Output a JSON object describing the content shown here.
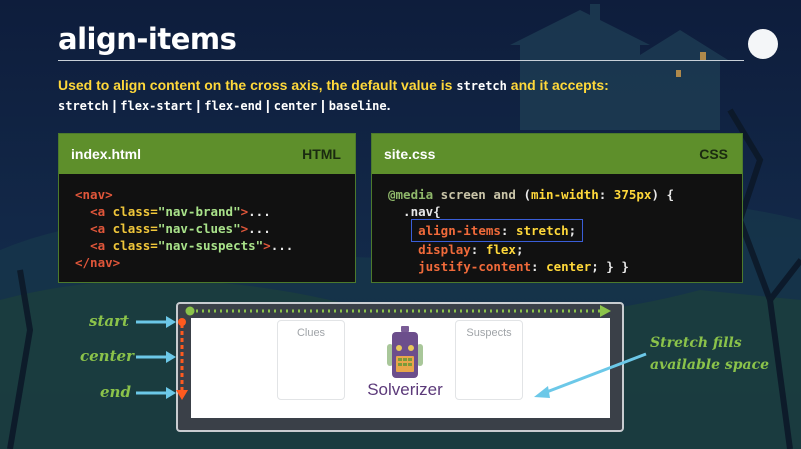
{
  "slide": {
    "title": "align-items",
    "subtitle_line1_pre": "Used to align content on the cross axis, the default value is ",
    "subtitle_line1_code": "stretch",
    "subtitle_line1_post": " and it accepts:",
    "accepted_values": [
      "stretch",
      "flex-start",
      "flex-end",
      "center",
      "baseline"
    ],
    "separator": " | ",
    "subtitle_line2_end": "."
  },
  "html_panel": {
    "filename": "index.html",
    "language": "HTML",
    "lines": [
      {
        "open": "<nav>"
      },
      {
        "indent": "  ",
        "tag": "<a",
        "attr": " class=",
        "str": "\"nav-brand\"",
        "close": ">",
        "txt": "..."
      },
      {
        "indent": "  ",
        "tag": "<a",
        "attr": " class=",
        "str": "\"nav-clues\"",
        "close": ">",
        "txt": "..."
      },
      {
        "indent": "  ",
        "tag": "<a",
        "attr": " class=",
        "str": "\"nav-suspects\"",
        "close": ">",
        "txt": "..."
      },
      {
        "open": "</nav>"
      }
    ]
  },
  "css_panel": {
    "filename": "site.css",
    "language": "CSS",
    "media_at": "@media",
    "media_screen": " screen and ",
    "media_paren_open": "(",
    "media_prop": "min-width",
    "media_colon": ": ",
    "media_val": "375px",
    "media_close": ") {",
    "selector": "  .nav{",
    "decl1_prop": "align-items",
    "decl1_val": "stretch",
    "decl2_prop": "display",
    "decl2_val": "flex",
    "decl3_prop": "justify-content",
    "decl3_val": "center",
    "decl3_tail": "; } }"
  },
  "demo": {
    "card_clues": "Clues",
    "card_suspects": "Suspects",
    "brand": "Solverizer"
  },
  "labels": {
    "start": "start",
    "center": "center",
    "end": "end",
    "note_line1": "Stretch fills",
    "note_line2": "available space"
  },
  "colors": {
    "accent_green": "#8bc34a",
    "panel_header": "#5e8f2b",
    "subtitle_yellow": "#ffd83a",
    "arrow_blue": "#6cc8e8",
    "axis_orange": "#ff5a1f"
  }
}
